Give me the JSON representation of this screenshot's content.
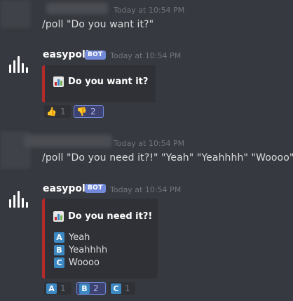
{
  "messages": [
    {
      "timestamp": "Today at 10:54 PM",
      "content": "/poll \"Do you want it?\""
    },
    {
      "username": "easypoll",
      "bot_tag": "BOT",
      "timestamp": "Today at 10:54 PM",
      "embed": {
        "title": "Do you want it?",
        "accent_color": "#b32a2a"
      },
      "reactions": [
        {
          "emoji": "thumbs-up",
          "glyph": "👍",
          "count": "1",
          "active": false
        },
        {
          "emoji": "thumbs-down",
          "glyph": "👎",
          "count": "2",
          "active": true
        }
      ]
    },
    {
      "timestamp": "Today at 10:54 PM",
      "content": "/poll \"Do you need it?!\" \"Yeah\" \"Yeahhhh\" \"Woooo\""
    },
    {
      "username": "easypoll",
      "bot_tag": "BOT",
      "timestamp": "Today at 10:54 PM",
      "embed": {
        "title": "Do you need it?!",
        "options": [
          {
            "letter": "A",
            "text": "Yeah"
          },
          {
            "letter": "B",
            "text": "Yeahhhh"
          },
          {
            "letter": "C",
            "text": "Woooo"
          }
        ]
      },
      "reactions": [
        {
          "emoji": "regional-a",
          "glyph": "A",
          "count": "1",
          "active": false
        },
        {
          "emoji": "regional-b",
          "glyph": "B",
          "count": "2",
          "active": true
        },
        {
          "emoji": "regional-c",
          "glyph": "C",
          "count": "1",
          "active": false
        }
      ]
    }
  ],
  "colors": {
    "background": "#36393f",
    "embed_bg": "#2f3136",
    "embed_accent": "#b32a2a",
    "bot_tag": "#7289da",
    "letter_box": "#3b88c3"
  }
}
